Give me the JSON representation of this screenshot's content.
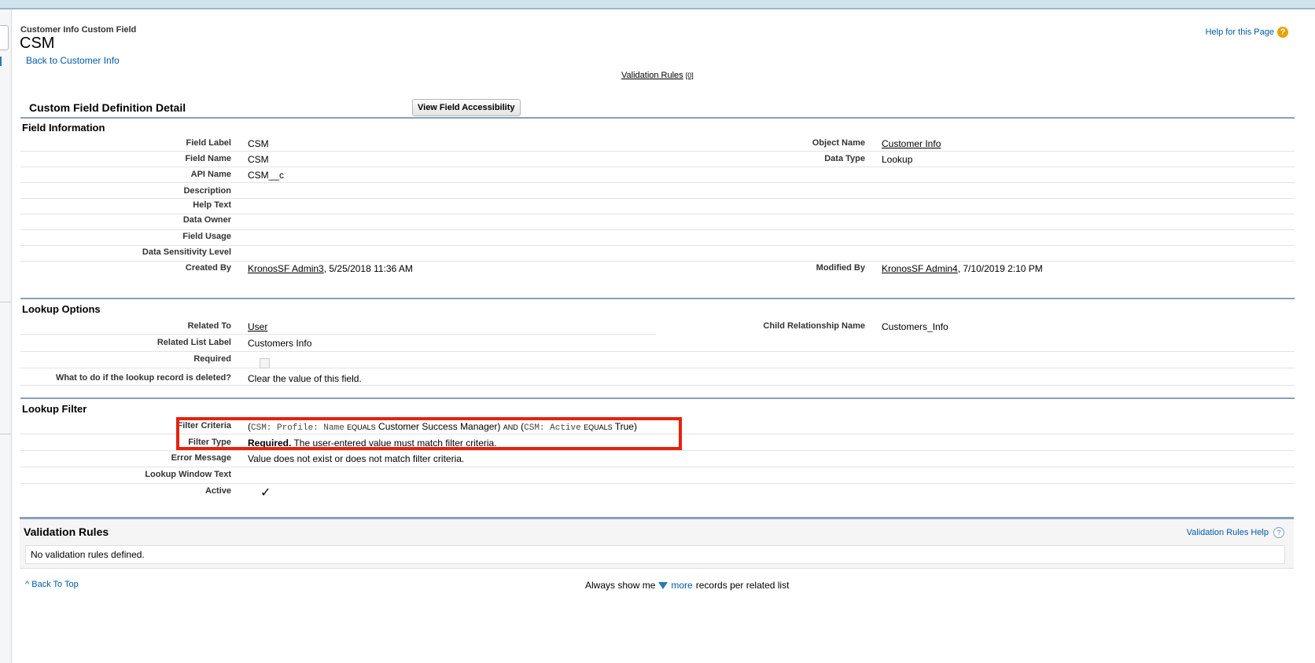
{
  "header": {
    "page_type": "Customer Info Custom Field",
    "title": "CSM",
    "back_link": "Back to Customer Info",
    "help_link": "Help for this Page",
    "help_icon": "help-icon",
    "validation_rules_link": "Validation Rules",
    "validation_rules_count": "[0]"
  },
  "detail": {
    "title": "Custom Field Definition Detail",
    "button_label": "View Field Accessibility"
  },
  "field_information": {
    "heading": "Field Information",
    "field_label_lbl": "Field Label",
    "field_label_val": "CSM",
    "field_name_lbl": "Field Name",
    "field_name_val": "CSM",
    "api_name_lbl": "API Name",
    "api_name_val": "CSM__c",
    "description_lbl": "Description",
    "help_text_lbl": "Help Text",
    "data_owner_lbl": "Data Owner",
    "field_usage_lbl": "Field Usage",
    "data_sensitivity_lbl": "Data Sensitivity Level",
    "created_by_lbl": "Created By",
    "created_by_user": "KronosSF Admin3",
    "created_by_date": ", 5/25/2018 11:36 AM",
    "object_name_lbl": "Object Name",
    "object_name_val": "Customer Info",
    "data_type_lbl": "Data Type",
    "data_type_val": "Lookup",
    "modified_by_lbl": "Modified By",
    "modified_by_user": "KronosSF Admin4",
    "modified_by_date": ", 7/10/2019 2:10 PM"
  },
  "lookup_options": {
    "heading": "Lookup Options",
    "related_to_lbl": "Related To",
    "related_to_val": "User",
    "related_list_label_lbl": "Related List Label",
    "related_list_label_val": "Customers Info",
    "required_lbl": "Required",
    "required_checked": false,
    "deleted_lbl": "What to do if the lookup record is deleted?",
    "deleted_val": "Clear the value of this field.",
    "child_rel_lbl": "Child Relationship Name",
    "child_rel_val": "Customers_Info"
  },
  "lookup_filter": {
    "heading": "Lookup Filter",
    "filter_criteria_lbl": "Filter Criteria",
    "fc_open1": "(",
    "fc_field1": "CSM: Profile: Name",
    "fc_op1": "EQUALS",
    "fc_value1": "Customer Success Manager)",
    "fc_and": "AND",
    "fc_open2": "(",
    "fc_field2": "CSM: Active",
    "fc_op2": "EQUALS",
    "fc_value2": "True)",
    "filter_type_lbl": "Filter Type",
    "filter_type_bold": "Required.",
    "filter_type_text": "The user-entered value must match filter criteria.",
    "error_message_lbl": "Error Message",
    "error_message_val": "Value does not exist or does not match filter criteria.",
    "lookup_window_lbl": "Lookup Window Text",
    "active_lbl": "Active",
    "active_mark": "✓"
  },
  "validation_rules": {
    "title": "Validation Rules",
    "help_link": "Validation Rules Help",
    "empty_text": "No validation rules defined."
  },
  "footer": {
    "back_to_top": "Back To Top",
    "always_show": "Always show me",
    "more": "more",
    "per_list": "records per related list"
  }
}
